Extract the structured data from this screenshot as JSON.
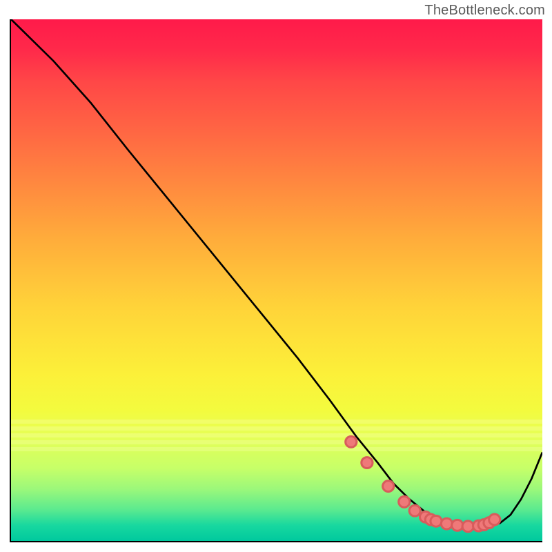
{
  "watermark": "TheBottleneck.com",
  "chart_data": {
    "type": "line",
    "title": "",
    "xlabel": "",
    "ylabel": "",
    "xlim": [
      0,
      100
    ],
    "ylim": [
      0,
      100
    ],
    "grid": false,
    "series": [
      {
        "name": "curve",
        "x": [
          0,
          2,
          8,
          15,
          22,
          30,
          38,
          46,
          54,
          60,
          65,
          69,
          72,
          75,
          78,
          81,
          84,
          86,
          88,
          90,
          92,
          94,
          96,
          98,
          100
        ],
        "y": [
          100,
          98,
          92,
          84,
          75,
          65,
          55,
          45,
          35,
          27,
          20,
          15,
          11,
          8,
          5.5,
          4,
          3,
          2.6,
          2.6,
          2.8,
          3.4,
          5,
          8,
          12,
          17
        ]
      }
    ],
    "marker_points": {
      "name": "dots",
      "x": [
        64,
        67,
        71,
        74,
        76,
        78,
        79,
        80,
        82,
        84,
        86,
        88,
        89,
        90,
        91
      ],
      "y": [
        19,
        15,
        10.5,
        7.5,
        5.8,
        4.6,
        4.1,
        3.8,
        3.3,
        3.0,
        2.8,
        2.9,
        3.1,
        3.5,
        4.1
      ]
    },
    "gradient": {
      "top_color": "#ff1a4a",
      "mid_color": "#ffd339",
      "bottom_color": "#00c99e"
    }
  }
}
